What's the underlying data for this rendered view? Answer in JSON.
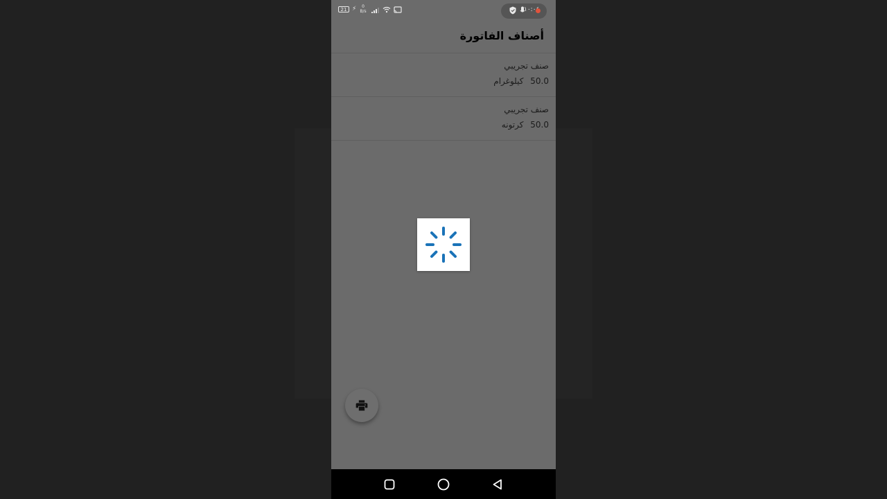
{
  "status_bar": {
    "battery_level": "21",
    "net_speed_value": "0",
    "net_speed_unit": "B/s",
    "time": "١٠:٠٤",
    "icons": [
      "battery-icon",
      "charging-icon",
      "signal-icon",
      "wifi-icon",
      "cast-icon",
      "shield-icon",
      "mic-icon",
      "recording-dot-icon"
    ]
  },
  "header": {
    "title": "أصناف الفاتورة"
  },
  "items": [
    {
      "name": "صنف تجريبي",
      "quantity": "50.0",
      "unit": "كيلوغرام"
    },
    {
      "name": "صنف تجريبي",
      "quantity": "50.0",
      "unit": "كرتونه"
    }
  ],
  "loading": {
    "icon": "spinner-icon",
    "color": "#1a73b8"
  },
  "fab": {
    "icon": "print-icon"
  },
  "nav": {
    "icons": [
      "recents-icon",
      "home-icon",
      "back-icon"
    ]
  },
  "colors": {
    "scrim": "#6b6b6b",
    "background": "#212121",
    "accent": "#1a73b8"
  }
}
